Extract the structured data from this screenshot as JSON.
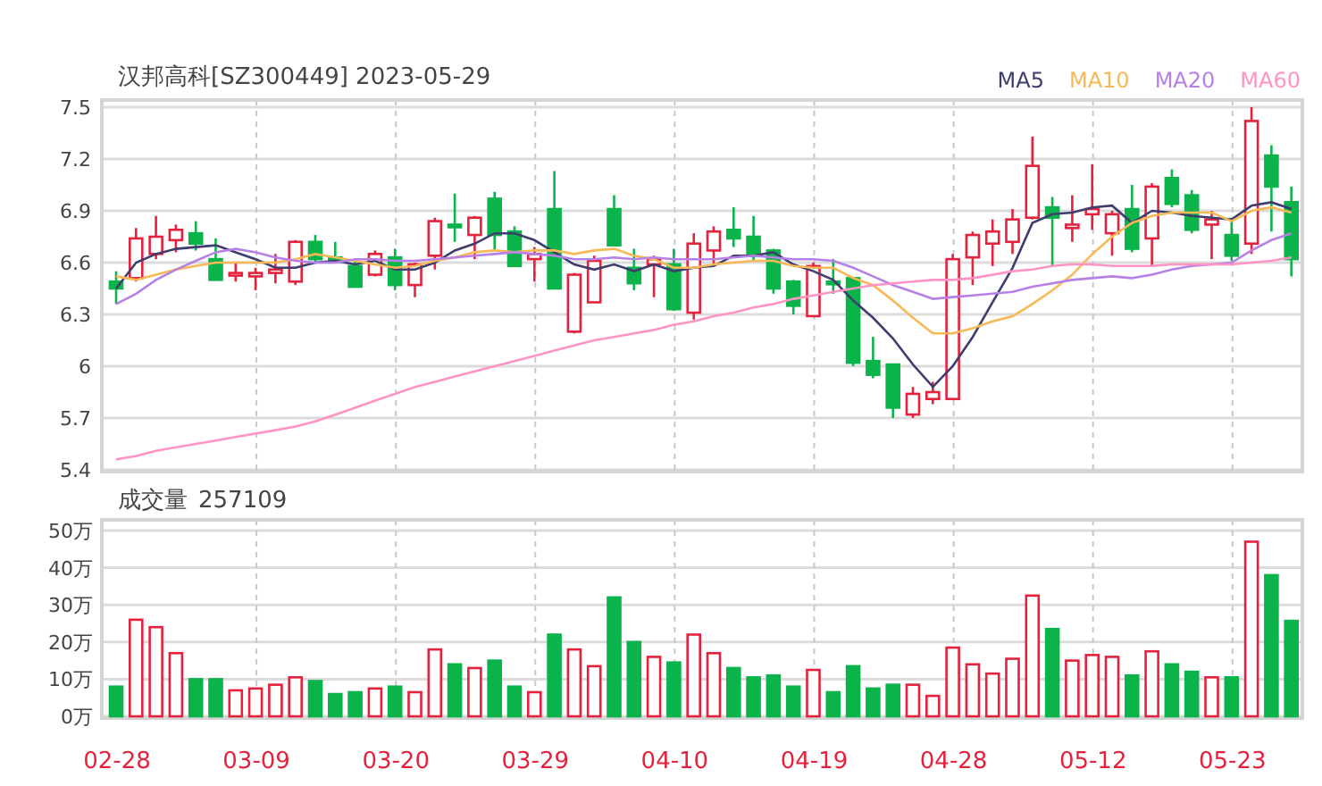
{
  "header": {
    "title": "汉邦高科[SZ300449] 2023-05-29"
  },
  "price_chart": {
    "chart_data": {
      "type": "line",
      "grid": true,
      "ylim": [
        5.4,
        7.5
      ],
      "yticks": [
        {
          "value": 7.5,
          "label": "7.5"
        },
        {
          "value": 7.2,
          "label": "7.2"
        },
        {
          "value": 6.9,
          "label": "6.9"
        },
        {
          "value": 6.6,
          "label": "6.6"
        },
        {
          "value": 6.3,
          "label": "6.3"
        },
        {
          "value": 6,
          "label": "6"
        },
        {
          "value": 5.7,
          "label": "5.7"
        },
        {
          "value": 5.4,
          "label": "5.4"
        }
      ],
      "series": [
        {
          "type": "candlestick",
          "ohlc": [
            [
              6.49,
              6.55,
              6.36,
              6.45
            ],
            [
              6.51,
              6.8,
              6.49,
              6.74
            ],
            [
              6.65,
              6.87,
              6.62,
              6.75
            ],
            [
              6.73,
              6.82,
              6.66,
              6.79
            ],
            [
              6.77,
              6.84,
              6.67,
              6.71
            ],
            [
              6.62,
              6.74,
              6.5,
              6.5
            ],
            [
              6.53,
              6.6,
              6.49,
              6.54
            ],
            [
              6.52,
              6.57,
              6.44,
              6.54
            ],
            [
              6.54,
              6.65,
              6.48,
              6.56
            ],
            [
              6.49,
              6.73,
              6.47,
              6.72
            ],
            [
              6.72,
              6.76,
              6.6,
              6.62
            ],
            [
              6.63,
              6.72,
              6.6,
              6.61
            ],
            [
              6.58,
              6.62,
              6.46,
              6.46
            ],
            [
              6.53,
              6.67,
              6.52,
              6.65
            ],
            [
              6.63,
              6.68,
              6.44,
              6.47
            ],
            [
              6.47,
              6.6,
              6.4,
              6.59
            ],
            [
              6.64,
              6.86,
              6.56,
              6.84
            ],
            [
              6.82,
              7.0,
              6.72,
              6.81
            ],
            [
              6.76,
              6.87,
              6.62,
              6.86
            ],
            [
              6.97,
              7.01,
              6.67,
              6.76
            ],
            [
              6.78,
              6.81,
              6.58,
              6.58
            ],
            [
              6.62,
              6.69,
              6.49,
              6.65
            ],
            [
              6.91,
              7.13,
              6.45,
              6.45
            ],
            [
              6.2,
              6.54,
              6.19,
              6.53
            ],
            [
              6.37,
              6.64,
              6.37,
              6.61
            ],
            [
              6.91,
              6.99,
              6.7,
              6.7
            ],
            [
              6.57,
              6.68,
              6.44,
              6.48
            ],
            [
              6.59,
              6.64,
              6.4,
              6.62
            ],
            [
              6.59,
              6.68,
              6.32,
              6.33
            ],
            [
              6.31,
              6.77,
              6.27,
              6.71
            ],
            [
              6.67,
              6.81,
              6.58,
              6.78
            ],
            [
              6.79,
              6.92,
              6.69,
              6.74
            ],
            [
              6.75,
              6.87,
              6.61,
              6.64
            ],
            [
              6.67,
              6.68,
              6.42,
              6.45
            ],
            [
              6.49,
              6.5,
              6.3,
              6.35
            ],
            [
              6.29,
              6.6,
              6.29,
              6.58
            ],
            [
              6.49,
              6.62,
              6.42,
              6.48
            ],
            [
              6.51,
              6.51,
              6.0,
              6.02
            ],
            [
              6.03,
              6.17,
              5.93,
              5.95
            ],
            [
              6.01,
              6.01,
              5.7,
              5.76
            ],
            [
              5.72,
              5.88,
              5.7,
              5.84
            ],
            [
              5.81,
              5.91,
              5.78,
              5.85
            ],
            [
              5.81,
              6.65,
              5.81,
              6.62
            ],
            [
              6.63,
              6.78,
              6.47,
              6.76
            ],
            [
              6.71,
              6.85,
              6.58,
              6.78
            ],
            [
              6.72,
              6.91,
              6.65,
              6.85
            ],
            [
              6.86,
              7.33,
              6.85,
              7.16
            ],
            [
              6.92,
              6.98,
              6.58,
              6.86
            ],
            [
              6.8,
              6.99,
              6.72,
              6.82
            ],
            [
              6.88,
              7.17,
              6.79,
              6.91
            ],
            [
              6.77,
              6.9,
              6.64,
              6.88
            ],
            [
              6.91,
              7.05,
              6.66,
              6.68
            ],
            [
              6.74,
              7.06,
              6.58,
              7.04
            ],
            [
              7.09,
              7.14,
              6.92,
              6.94
            ],
            [
              6.99,
              7.02,
              6.77,
              6.79
            ],
            [
              6.82,
              6.9,
              6.62,
              6.85
            ],
            [
              6.76,
              6.86,
              6.61,
              6.64
            ],
            [
              6.71,
              7.5,
              6.65,
              7.42
            ],
            [
              7.22,
              7.28,
              6.78,
              7.04
            ],
            [
              6.95,
              7.04,
              6.52,
              6.62
            ]
          ]
        },
        {
          "name": "MA5",
          "color": "#3e3d6e",
          "values": [
            6.45,
            6.6,
            6.65,
            6.68,
            6.69,
            6.7,
            6.66,
            6.62,
            6.57,
            6.57,
            6.6,
            6.61,
            6.59,
            6.61,
            6.56,
            6.56,
            6.6,
            6.67,
            6.71,
            6.77,
            6.77,
            6.73,
            6.66,
            6.59,
            6.56,
            6.59,
            6.55,
            6.59,
            6.55,
            6.57,
            6.58,
            6.64,
            6.64,
            6.66,
            6.59,
            6.55,
            6.5,
            6.38,
            6.28,
            6.16,
            6.01,
            5.88,
            6.0,
            6.17,
            6.37,
            6.57,
            6.83,
            6.88,
            6.89,
            6.92,
            6.93,
            6.83,
            6.9,
            6.89,
            6.87,
            6.86,
            6.85,
            6.93,
            6.95,
            6.91
          ]
        },
        {
          "name": "MA10",
          "color": "#f7b955",
          "values": [
            6.52,
            6.5,
            6.53,
            6.56,
            6.58,
            6.6,
            6.6,
            6.6,
            6.6,
            6.62,
            6.65,
            6.63,
            6.61,
            6.59,
            6.57,
            6.58,
            6.61,
            6.63,
            6.66,
            6.67,
            6.66,
            6.67,
            6.67,
            6.65,
            6.67,
            6.68,
            6.64,
            6.62,
            6.57,
            6.57,
            6.59,
            6.6,
            6.61,
            6.61,
            6.58,
            6.57,
            6.57,
            6.51,
            6.47,
            6.38,
            6.28,
            6.19,
            6.19,
            6.22,
            6.26,
            6.29,
            6.36,
            6.44,
            6.53,
            6.65,
            6.75,
            6.83,
            6.87,
            6.89,
            6.89,
            6.89,
            6.84,
            6.9,
            6.92,
            6.89
          ]
        },
        {
          "name": "MA20",
          "color": "#b680e6",
          "values": [
            6.36,
            6.42,
            6.5,
            6.56,
            6.61,
            6.66,
            6.68,
            6.66,
            6.63,
            6.61,
            6.6,
            6.6,
            6.62,
            6.62,
            6.61,
            6.61,
            6.62,
            6.63,
            6.64,
            6.65,
            6.66,
            6.65,
            6.64,
            6.62,
            6.62,
            6.63,
            6.62,
            6.63,
            6.62,
            6.62,
            6.62,
            6.63,
            6.64,
            6.63,
            6.62,
            6.62,
            6.61,
            6.57,
            6.52,
            6.47,
            6.43,
            6.39,
            6.4,
            6.41,
            6.42,
            6.43,
            6.46,
            6.48,
            6.5,
            6.51,
            6.52,
            6.51,
            6.53,
            6.56,
            6.58,
            6.59,
            6.6,
            6.67,
            6.73,
            6.77
          ]
        },
        {
          "name": "MA60",
          "color": "#ff94c4",
          "values": [
            5.46,
            5.48,
            5.51,
            5.53,
            5.55,
            5.57,
            5.59,
            5.61,
            5.63,
            5.65,
            5.68,
            5.72,
            5.76,
            5.8,
            5.84,
            5.88,
            5.91,
            5.94,
            5.97,
            6.0,
            6.03,
            6.06,
            6.09,
            6.12,
            6.15,
            6.17,
            6.19,
            6.21,
            6.24,
            6.26,
            6.29,
            6.31,
            6.34,
            6.36,
            6.39,
            6.41,
            6.43,
            6.45,
            6.47,
            6.48,
            6.49,
            6.5,
            6.5,
            6.51,
            6.53,
            6.55,
            6.56,
            6.58,
            6.59,
            6.59,
            6.58,
            6.58,
            6.58,
            6.59,
            6.59,
            6.59,
            6.59,
            6.6,
            6.61,
            6.63
          ]
        }
      ]
    }
  },
  "volume_chart": {
    "label": "成交量",
    "value": "257109",
    "chart_data": {
      "type": "bar",
      "grid": true,
      "ylim": [
        0,
        50
      ],
      "categories": [
        "02-28",
        null,
        null,
        null,
        null,
        null,
        null,
        "03-09",
        null,
        null,
        null,
        null,
        null,
        null,
        "03-20",
        null,
        null,
        null,
        null,
        null,
        null,
        "03-29",
        null,
        null,
        null,
        null,
        null,
        null,
        "04-10",
        null,
        null,
        null,
        null,
        null,
        null,
        "04-19",
        null,
        null,
        null,
        null,
        null,
        null,
        "04-28",
        null,
        null,
        null,
        null,
        null,
        null,
        "05-12",
        null,
        null,
        null,
        null,
        null,
        null,
        "05-23",
        null,
        null,
        null
      ],
      "yticks": [
        {
          "value": 50,
          "label": "50万"
        },
        {
          "value": 40,
          "label": "40万"
        },
        {
          "value": 30,
          "label": "30万"
        },
        {
          "value": 20,
          "label": "20万"
        },
        {
          "value": 10,
          "label": "10万"
        },
        {
          "value": 0,
          "label": "0万"
        }
      ],
      "values": [
        8,
        26,
        24,
        17,
        10,
        10,
        7,
        7.5,
        8.5,
        10.5,
        9.5,
        6,
        6.5,
        7.5,
        8,
        6.5,
        18,
        14,
        13,
        15,
        8,
        6.5,
        22,
        18,
        13.5,
        32,
        20,
        16,
        14.5,
        22,
        17,
        13,
        10.5,
        11,
        8,
        12.5,
        6.5,
        13.5,
        7.5,
        8.5,
        8.5,
        5.5,
        18.5,
        14,
        11.5,
        15.5,
        32.5,
        23.5,
        15,
        16.5,
        16,
        11,
        17.5,
        14,
        12,
        10.5,
        10.5,
        47,
        38,
        25.7
      ]
    }
  }
}
